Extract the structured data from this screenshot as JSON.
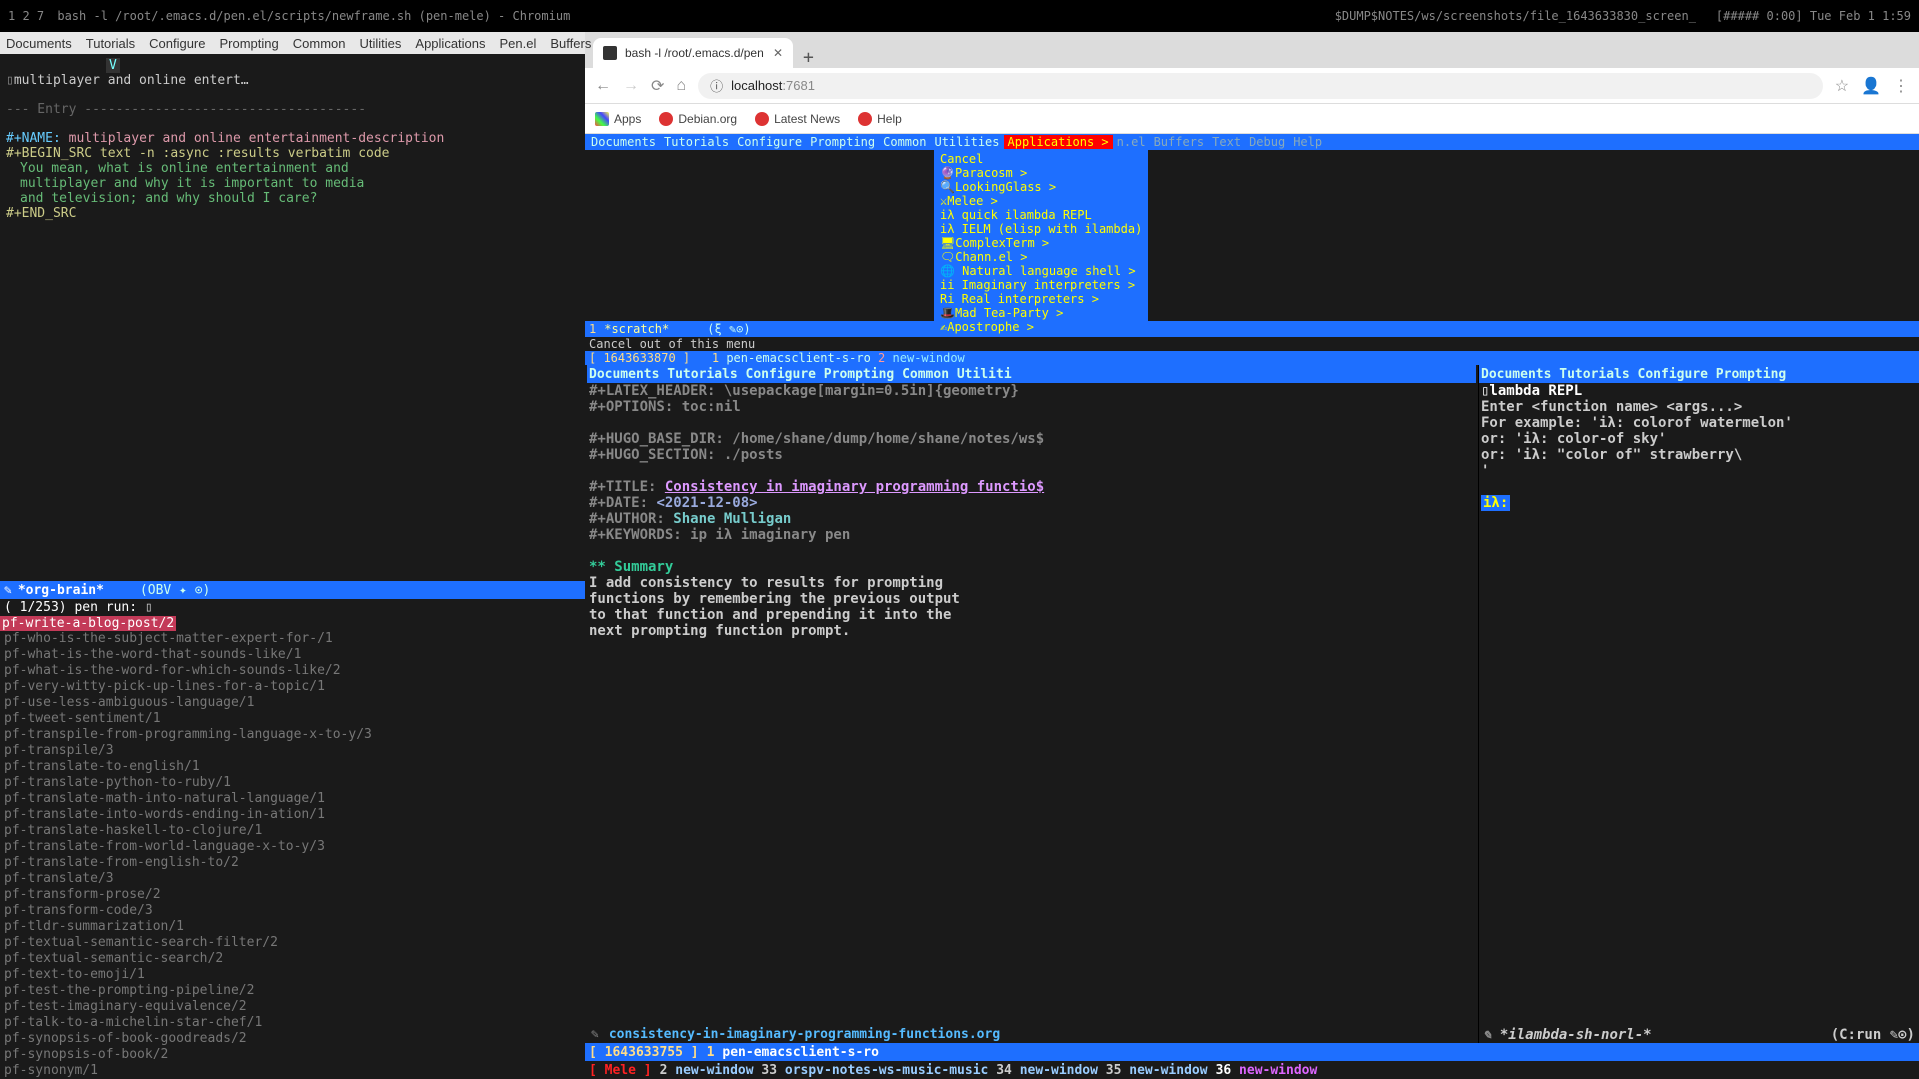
{
  "topbar": {
    "workspaces": "1 2 7",
    "title": "bash -l /root/.emacs.d/pen.el/scripts/newframe.sh (pen-mele) - Chromium",
    "path": "$DUMP$NOTES/ws/screenshots/file_1643633830_screen_",
    "time": "[##### 0:00]  Tue Feb  1  1:59"
  },
  "left_menu": [
    "Documents",
    "Tutorials",
    "Configure",
    "Prompting",
    "Common",
    "Utilities",
    "Applications",
    "Pen.el",
    "Buffers"
  ],
  "org": {
    "v": "V",
    "heading": "multiplayer and online entert…",
    "entry_sep": "--- Entry ------------------------------------",
    "name_kw": "#+NAME:",
    "name_val": "multiplayer and online entertainment-description",
    "begin": "#+BEGIN_SRC text -n :async :results verbatim code",
    "src1": "You mean, what is online entertainment and",
    "src2": "multiplayer and why it is important to media",
    "src3": "and television; and why should I care?",
    "end": "#+END_SRC"
  },
  "modeline1": {
    "icon": "✎",
    "buffer": "*org-brain*",
    "mode": "(OBV ✦ ⊙)"
  },
  "counter": {
    "count": "(  1/253) pen run:",
    "cursor": "▯"
  },
  "selected_item": "pf-write-a-blog-post/2",
  "pen_list": [
    "pf-who-is-the-subject-matter-expert-for-/1",
    "pf-what-is-the-word-that-sounds-like/1",
    "pf-what-is-the-word-for-which-sounds-like/2",
    "pf-very-witty-pick-up-lines-for-a-topic/1",
    "pf-use-less-ambiguous-language/1",
    "pf-tweet-sentiment/1",
    "pf-transpile-from-programming-language-x-to-y/3",
    "pf-transpile/3",
    "pf-translate-to-english/1",
    "pf-translate-python-to-ruby/1",
    "pf-translate-math-into-natural-language/1",
    "pf-translate-into-words-ending-in-ation/1",
    "pf-translate-haskell-to-clojure/1",
    "pf-translate-from-world-language-x-to-y/3",
    "pf-translate-from-english-to/2",
    "pf-translate/3",
    "pf-transform-prose/2",
    "pf-transform-code/3",
    "pf-tldr-summarization/1",
    "pf-textual-semantic-search-filter/2",
    "pf-textual-semantic-search/2",
    "pf-text-to-emoji/1",
    "pf-test-the-prompting-pipeline/2",
    "pf-test-imaginary-equivalence/2",
    "pf-talk-to-a-michelin-star-chef/1",
    "pf-synopsis-of-book-goodreads/2",
    "pf-synopsis-of-book/2",
    "pf-synonym/1"
  ],
  "browser": {
    "tab_title": "bash -l /root/.emacs.d/pen",
    "host": "localhost",
    "port": ":7681",
    "bookmarks": [
      {
        "label": "Apps",
        "type": "apps"
      },
      {
        "label": "Debian.org",
        "type": "debian"
      },
      {
        "label": "Latest News",
        "type": "news"
      },
      {
        "label": "Help",
        "type": "help"
      }
    ]
  },
  "inner_menu": [
    "Documents",
    "Tutorials",
    "Configure",
    "Prompting",
    "Common",
    "Utilities"
  ],
  "inner_menu_hl": "Applications >",
  "inner_menu_after": [
    "n.el",
    "Buffers",
    "Text",
    "Debug",
    "Help"
  ],
  "dropdown": [
    "Cancel",
    "🔮Paracosm >",
    "🔍LookingGlass >",
    "⚔Melee >",
    "iλ quick ilambda REPL",
    "iλ IELM (elisp with ilambda)",
    "🖥ComplexTerm >",
    "🗨Chann.el >",
    "🌐 Natural language shell >",
    "ii Imaginary interpreters >",
    "Ri Real interpreters >",
    "🎩Mad Tea-Party >",
    "✍Apostrophe >"
  ],
  "scratch": {
    "num": "1",
    "name": "*scratch*",
    "mode": "(ξ ✎⊙)",
    "cancel": "Cancel out of this menu",
    "status_ts": "[ 1643633870 ]",
    "status_n": "1",
    "status_proc": "pen-emacsclient-s-ro",
    "status_n2": "2",
    "status_nw": "new-window"
  },
  "doc_menu": "Documents Tutorials Configure Prompting Common Utiliti",
  "repl_menu": "Documents Tutorials Configure Prompting",
  "doc": {
    "latex": "#+LATEX_HEADER: \\usepackage[margin=0.5in]{geometry}",
    "opts": "#+OPTIONS: toc:nil",
    "hugodir": "#+HUGO_BASE_DIR: /home/shane/dump/home/shane/notes/ws$",
    "hugosec": "#+HUGO_SECTION: ./posts",
    "title_kw": "#+TITLE: ",
    "title": "Consistency in imaginary programming functio$",
    "date_kw": "#+DATE: ",
    "date": "<2021-12-08>",
    "author_kw": "#+AUTHOR: ",
    "author": "Shane Mulligan",
    "keywords": "#+KEYWORDS: ip iλ imaginary pen",
    "sumh": "** Summary",
    "b1": "I add consistency to results for prompting",
    "b2": "functions by remembering the previous output",
    "b3": "to that function and prepending it into the",
    "b4": "next prompting function prompt.",
    "modeline_icon": "✎",
    "modeline_file": "consistency-in-imaginary-programming-functions.org"
  },
  "repl": {
    "hdr": "▯lambda REPL",
    "l1": "Enter <function name> <args...>",
    "l2": "For example: 'iλ: colorof watermelon'",
    "l3": "         or: 'iλ: color-of sky'",
    "l4": "         or: 'iλ: \"color of\" strawberry\\",
    "l5": "'",
    "prompt": "iλ:",
    "modeline_icon": "✎",
    "modeline_name": "*ilambda-sh-norl-*",
    "modeline_run": "(C:run ✎⊙)"
  },
  "final_status": {
    "ts": "[ 1643633755 ]",
    "n": "1",
    "proc": "pen-emacsclient-s-ro"
  },
  "final_tmux": {
    "mele": "[ Mele ]",
    "items": [
      {
        "n": "2",
        "name": "new-window"
      },
      {
        "n": "33",
        "name": "orspv-notes-ws-music-music"
      },
      {
        "n": "34",
        "name": "new-window"
      },
      {
        "n": "35",
        "name": "new-window"
      }
    ],
    "hl": {
      "n": "36",
      "name": "new-window"
    }
  }
}
